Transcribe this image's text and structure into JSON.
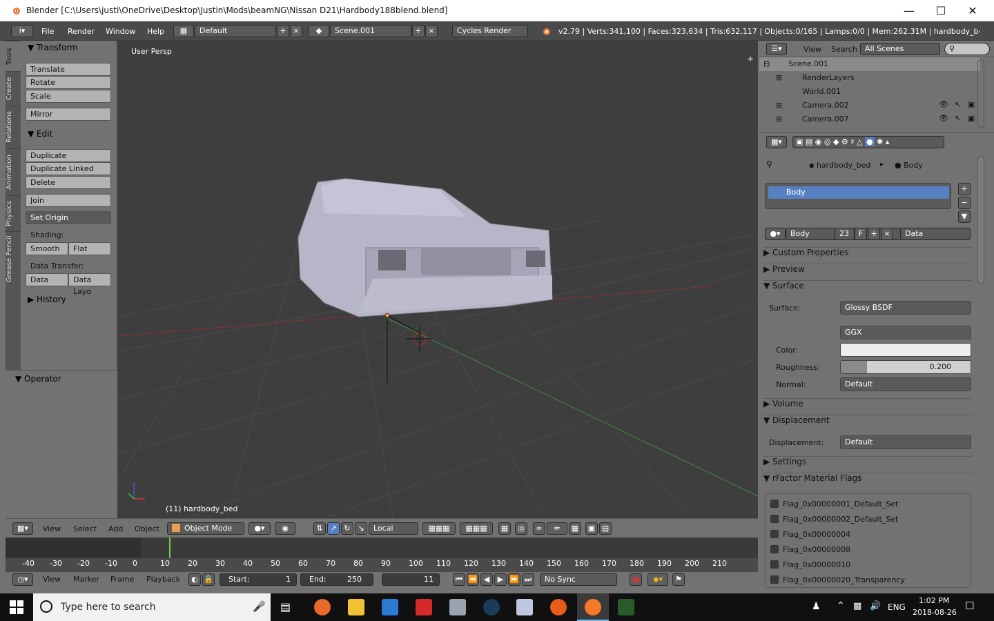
{
  "window": {
    "title": "Blender [C:\\Users\\justi\\OneDrive\\Desktop\\Justin\\Mods\\beamNG\\Nissan D21\\Hardbody188blend.blend]"
  },
  "menu": {
    "items": [
      "File",
      "Render",
      "Window",
      "Help"
    ]
  },
  "layout": {
    "name": "Default"
  },
  "scene": {
    "name": "Scene.001"
  },
  "engine": {
    "name": "Cycles Render"
  },
  "stats": "v2.79 | Verts:341,100 | Faces:323,634 | Tris:632,117 | Objects:0/165 | Lamps:0/0 | Mem:262.31M | hardbody_bed",
  "tabs": [
    "Tools",
    "Create",
    "Relations",
    "Animation",
    "Physics",
    "Grease Pencil"
  ],
  "toolshelf": {
    "transform_title": "Transform",
    "translate": "Translate",
    "rotate": "Rotate",
    "scale": "Scale",
    "mirror": "Mirror",
    "edit_title": "Edit",
    "duplicate": "Duplicate",
    "duplicate_linked": "Duplicate Linked",
    "delete": "Delete",
    "join": "Join",
    "set_origin": "Set Origin",
    "shading_label": "Shading:",
    "smooth": "Smooth",
    "flat": "Flat",
    "data_transfer_label": "Data Transfer:",
    "data": "Data",
    "data_layout": "Data Layo",
    "history_title": "History",
    "operator_title": "Operator"
  },
  "viewport": {
    "label": "User Persp",
    "object_label": "(11) hardbody_bed"
  },
  "vp_header": {
    "view": "View",
    "select": "Select",
    "add": "Add",
    "object": "Object",
    "mode": "Object Mode",
    "pivot": "Local"
  },
  "timeline": {
    "ticks": [
      "-40",
      "-30",
      "-20",
      "-10",
      "0",
      "10",
      "20",
      "30",
      "40",
      "50",
      "60",
      "70",
      "80",
      "90",
      "100",
      "110",
      "120",
      "130",
      "140",
      "150",
      "160",
      "170",
      "180",
      "190",
      "200",
      "210"
    ]
  },
  "tl_header": {
    "view": "View",
    "marker": "Marker",
    "frame": "Frame",
    "playback": "Playback",
    "start_label": "Start:",
    "start": "1",
    "end_label": "End:",
    "end": "250",
    "current": "11",
    "sync": "No Sync"
  },
  "outliner": {
    "view": "View",
    "search": "Search",
    "filter": "All Scenes",
    "rows": [
      "Scene.001",
      "RenderLayers",
      "World.001",
      "Camera.002",
      "Camera.007"
    ]
  },
  "properties": {
    "breadcrumb_object": "hardbody_bed",
    "breadcrumb_material": "Body",
    "slot_name": "Body",
    "material_name": "Body",
    "users": "23",
    "fake": "F",
    "link": "Data",
    "sections": {
      "custom_properties": "Custom Properties",
      "preview": "Preview",
      "surface": "Surface",
      "volume": "Volume",
      "displacement": "Displacement",
      "settings": "Settings",
      "rfactor": "rFactor Material Flags"
    },
    "surface_label": "Surface:",
    "surface_value": "Glossy BSDF",
    "distribution": "GGX",
    "color_label": "Color:",
    "roughness_label": "Roughness:",
    "roughness_value": "0.200",
    "normal_label": "Normal:",
    "normal_value": "Default",
    "displacement_label": "Displacement:",
    "displacement_value": "Default",
    "flags": [
      "Flag_0x00000001_Default_Set",
      "Flag_0x00000002_Default_Set",
      "Flag_0x00000004",
      "Flag_0x00000008",
      "Flag_0x00000010",
      "Flag_0x00000020_Transparency"
    ]
  },
  "taskbar": {
    "search_placeholder": "Type here to search",
    "lang": "ENG",
    "time": "1:02 PM",
    "date": "2018-08-26"
  },
  "colors": {
    "selected": "#5680c2",
    "bg": "#727272",
    "viewport": "#3e3e3e"
  }
}
